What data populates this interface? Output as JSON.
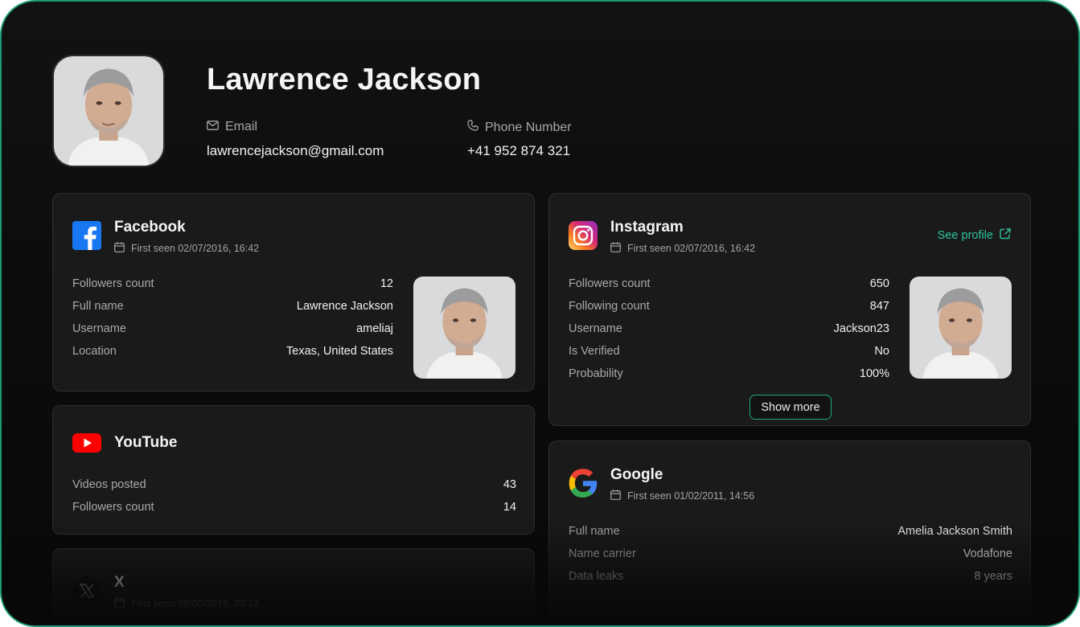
{
  "profile": {
    "name": "Lawrence Jackson",
    "email_label": "Email",
    "email": "lawrencejackson@gmail.com",
    "phone_label": "Phone Number",
    "phone": "+41 952 874 321"
  },
  "facebook": {
    "title": "Facebook",
    "first_seen": "First seen 02/07/2016, 16:42",
    "rows": [
      {
        "k": "Followers count",
        "v": "12"
      },
      {
        "k": "Full name",
        "v": "Lawrence Jackson"
      },
      {
        "k": "Username",
        "v": "ameliaj"
      },
      {
        "k": "Location",
        "v": "Texas, United States"
      }
    ]
  },
  "instagram": {
    "title": "Instagram",
    "first_seen": "First seen 02/07/2016, 16:42",
    "see_profile": "See profile",
    "show_more": "Show more",
    "rows": [
      {
        "k": "Followers count",
        "v": "650"
      },
      {
        "k": "Following count",
        "v": "847"
      },
      {
        "k": "Username",
        "v": "Jackson23"
      },
      {
        "k": "Is Verified",
        "v": "No"
      },
      {
        "k": "Probability",
        "v": "100%"
      }
    ]
  },
  "youtube": {
    "title": "YouTube",
    "rows": [
      {
        "k": "Videos posted",
        "v": "43"
      },
      {
        "k": "Followers count",
        "v": "14"
      }
    ]
  },
  "google": {
    "title": "Google",
    "first_seen": "First seen 01/02/2011, 14:56",
    "rows": [
      {
        "k": "Full name",
        "v": "Amelia Jackson Smith"
      },
      {
        "k": "Name carrier",
        "v": "Vodafone"
      },
      {
        "k": "Data leaks",
        "v": "8 years"
      }
    ]
  },
  "x": {
    "title": "X",
    "first_seen": "First seen 08/06/2015, 23:12"
  },
  "colors": {
    "accent": "#1ea886",
    "card_bg": "#1a1a1a",
    "card_border": "#2f2f2f",
    "facebook": "#1877f2",
    "youtube": "#ff0000"
  }
}
